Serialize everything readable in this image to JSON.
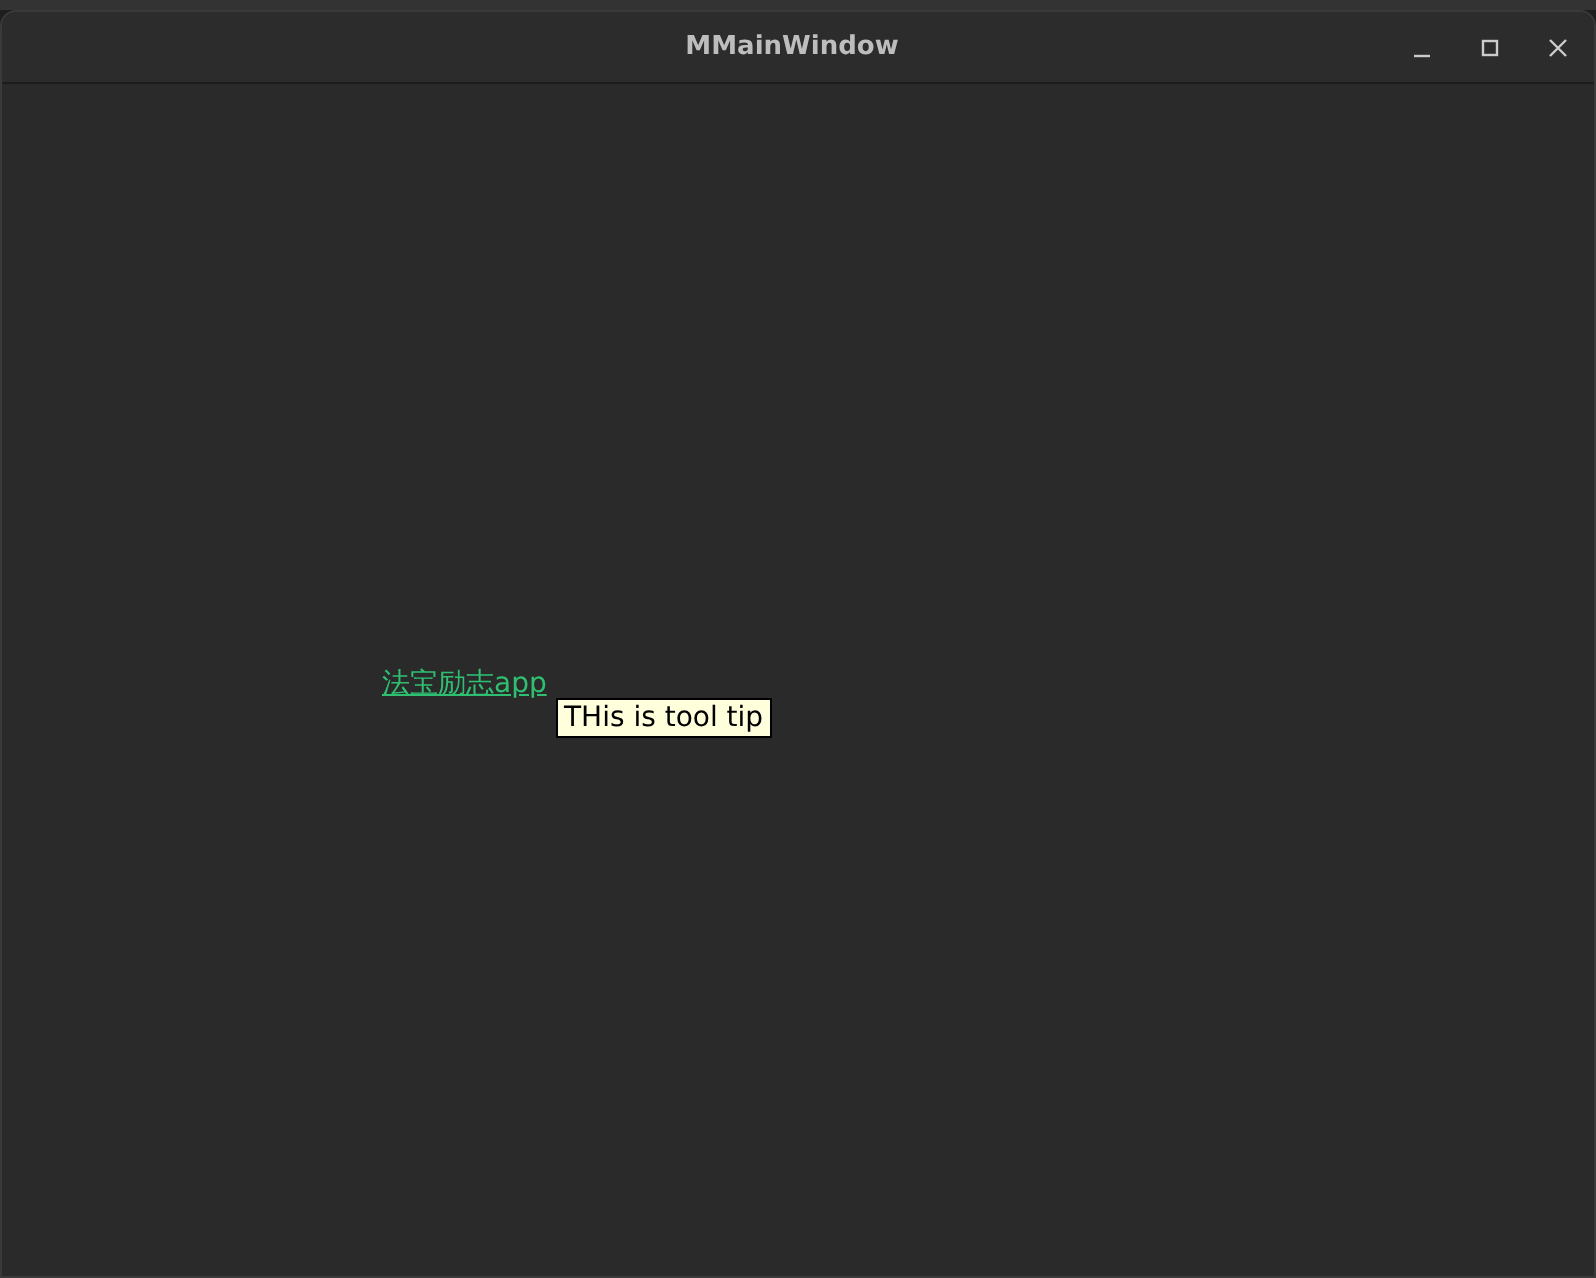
{
  "window": {
    "title": "MMainWindow"
  },
  "link": {
    "label": "法宝励志app"
  },
  "tooltip": {
    "text": "THis is tool tip"
  }
}
